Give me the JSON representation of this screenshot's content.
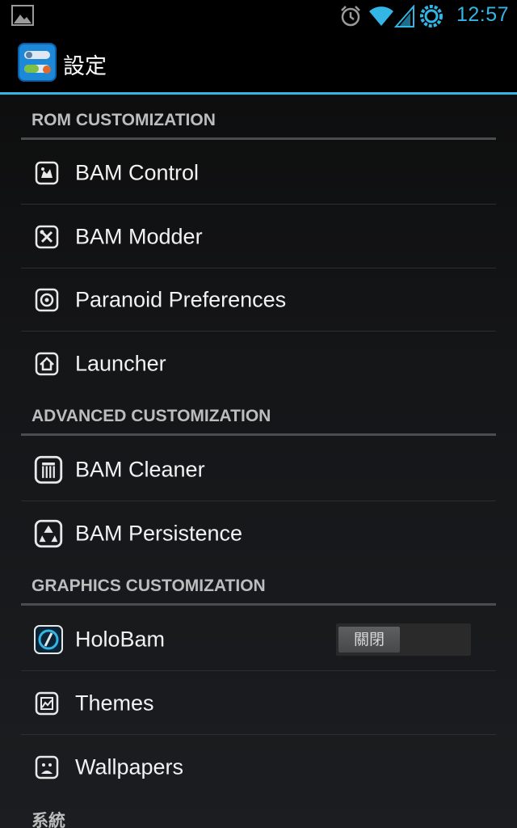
{
  "status_bar": {
    "time": "12:57",
    "icons": [
      "image-notification-icon",
      "alarm-icon",
      "wifi-icon",
      "signal-icon",
      "sync-icon"
    ]
  },
  "action_bar": {
    "title": "設定",
    "icon": "settings-app-icon"
  },
  "sections": [
    {
      "header": "ROM CUSTOMIZATION",
      "items": [
        {
          "label": "BAM Control",
          "icon": "bam-control-icon"
        },
        {
          "label": "BAM Modder",
          "icon": "tools-icon"
        },
        {
          "label": "Paranoid Preferences",
          "icon": "paranoid-icon"
        },
        {
          "label": "Launcher",
          "icon": "home-icon"
        }
      ]
    },
    {
      "header": "ADVANCED CUSTOMIZATION",
      "items": [
        {
          "label": "BAM Cleaner",
          "icon": "trash-icon"
        },
        {
          "label": "BAM Persistence",
          "icon": "recycle-icon"
        }
      ]
    },
    {
      "header": "GRAPHICS CUSTOMIZATION",
      "items": [
        {
          "label": "HoloBam",
          "icon": "holobam-icon",
          "toggle": {
            "label": "關閉",
            "state": "off"
          }
        },
        {
          "label": "Themes",
          "icon": "themes-icon"
        },
        {
          "label": "Wallpapers",
          "icon": "wallpaper-icon"
        }
      ]
    },
    {
      "header": "系統",
      "items": []
    }
  ],
  "colors": {
    "accent": "#33b5e5",
    "background": "#141517",
    "header_text": "#bdbdbd",
    "divider": "#2c2e31"
  }
}
